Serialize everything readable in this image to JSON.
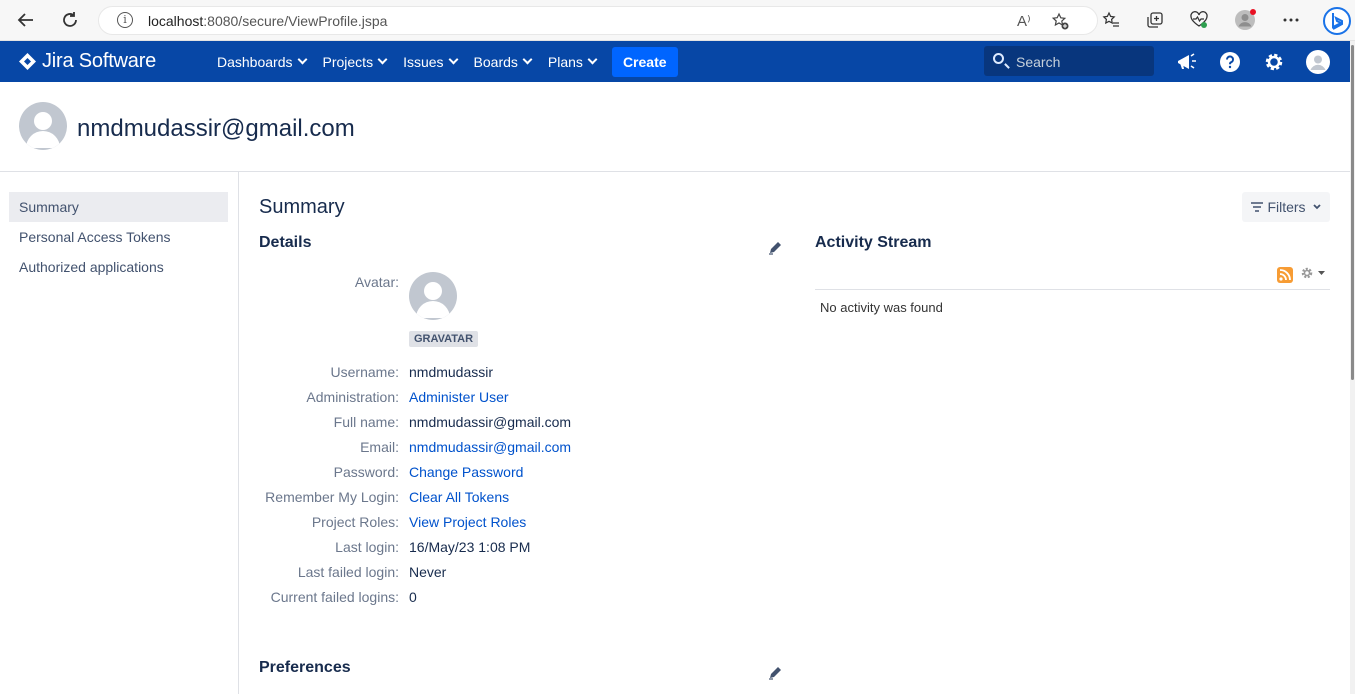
{
  "browser": {
    "url_host": "localhost",
    "url_path": ":8080/secure/ViewProfile.jspa",
    "read_aloud_label": "A⁾"
  },
  "header": {
    "logo_text": "Jira Software",
    "nav": [
      {
        "label": "Dashboards"
      },
      {
        "label": "Projects"
      },
      {
        "label": "Issues"
      },
      {
        "label": "Boards"
      },
      {
        "label": "Plans"
      }
    ],
    "create_label": "Create",
    "search_placeholder": "Search",
    "accent_color": "#0747a6",
    "create_color": "#0065ff"
  },
  "profile": {
    "name": "nmdmudassir@gmail.com"
  },
  "sidebar": {
    "items": [
      {
        "label": "Summary",
        "active": true
      },
      {
        "label": "Personal Access Tokens",
        "active": false
      },
      {
        "label": "Authorized applications",
        "active": false
      }
    ]
  },
  "main": {
    "title": "Summary",
    "filters_label": "Filters",
    "details_title": "Details",
    "preferences_title": "Preferences",
    "avatar_label": "Avatar:",
    "gravatar_badge": "GRAVATAR",
    "details": [
      {
        "label": "Username:",
        "value": "nmdmudassir",
        "link": false
      },
      {
        "label": "Administration:",
        "value": "Administer User",
        "link": true
      },
      {
        "label": "Full name:",
        "value": "nmdmudassir@gmail.com",
        "link": false
      },
      {
        "label": "Email:",
        "value": "nmdmudassir@gmail.com",
        "link": true
      },
      {
        "label": "Password:",
        "value": "Change Password",
        "link": true
      },
      {
        "label": "Remember My Login:",
        "value": "Clear All Tokens",
        "link": true
      },
      {
        "label": "Project Roles:",
        "value": "View Project Roles",
        "link": true
      },
      {
        "label": "Last login:",
        "value": "16/May/23 1:08 PM",
        "link": false
      },
      {
        "label": "Last failed login:",
        "value": "Never",
        "link": false
      },
      {
        "label": "Current failed logins:",
        "value": "0",
        "link": false
      }
    ],
    "activity": {
      "title": "Activity Stream",
      "empty_text": "No activity was found"
    }
  }
}
